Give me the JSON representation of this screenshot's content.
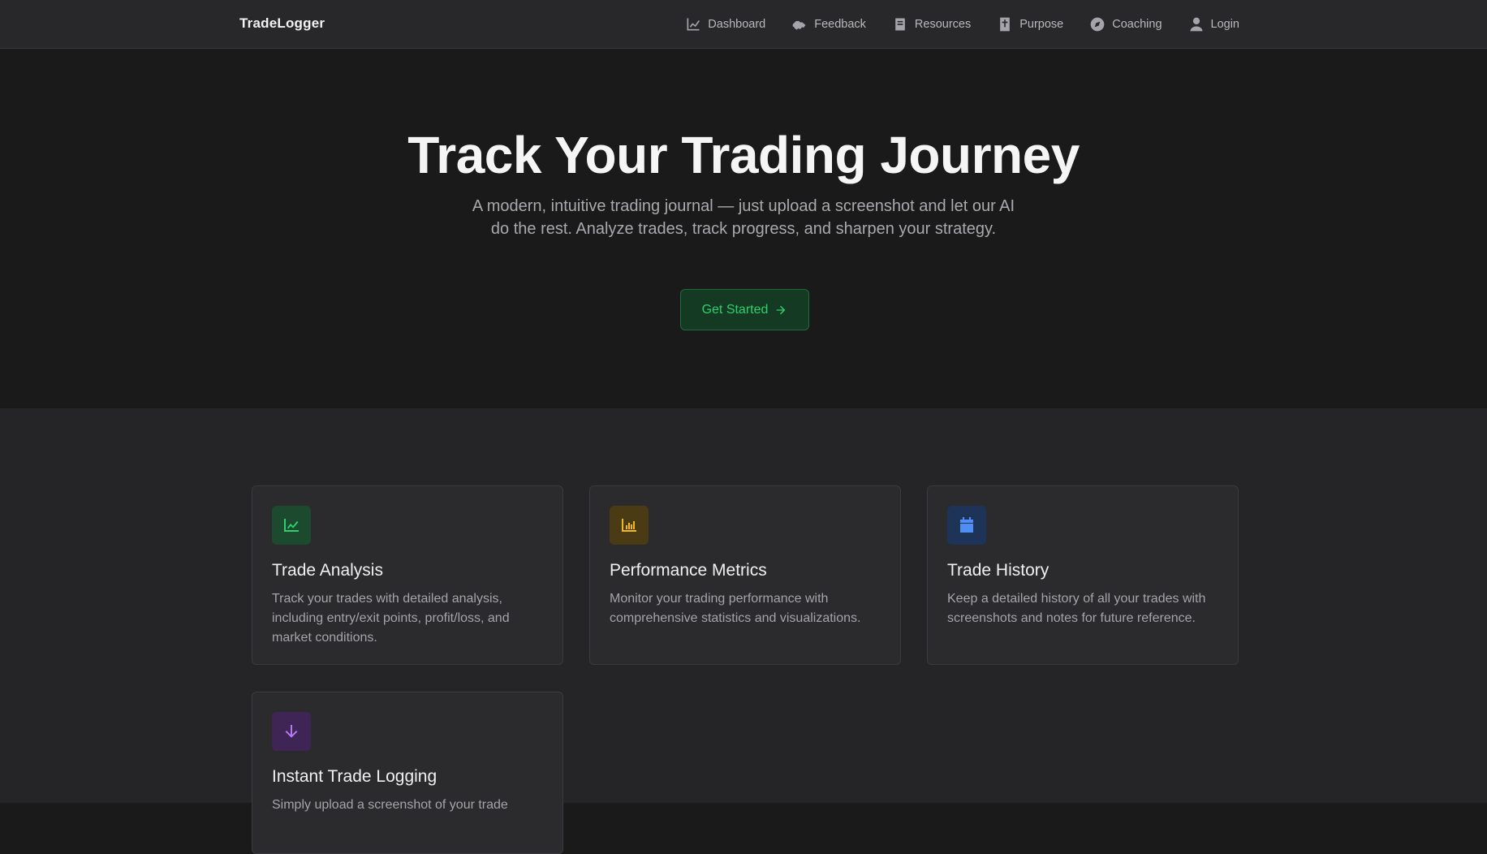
{
  "brand": "TradeLogger",
  "nav": [
    {
      "label": "Dashboard",
      "icon": "chart-line-icon"
    },
    {
      "label": "Feedback",
      "icon": "handshake-icon"
    },
    {
      "label": "Resources",
      "icon": "book-icon"
    },
    {
      "label": "Purpose",
      "icon": "bible-icon"
    },
    {
      "label": "Coaching",
      "icon": "compass-icon"
    },
    {
      "label": "Login",
      "icon": "user-icon"
    }
  ],
  "hero": {
    "title": "Track Your Trading Journey",
    "subtitle": "A modern, intuitive trading journal — just upload a screenshot and let our AI do the rest. Analyze trades, track progress, and sharpen your strategy.",
    "cta_label": "Get Started"
  },
  "features": [
    {
      "title": "Trade Analysis",
      "description": "Track your trades with detailed analysis, including entry/exit points, profit/loss, and market conditions.",
      "icon": "trend-chart-icon",
      "color": "#2fd06a"
    },
    {
      "title": "Performance Metrics",
      "description": "Monitor your trading performance with comprehensive statistics and visualizations.",
      "icon": "bar-chart-icon",
      "color": "#f2b822"
    },
    {
      "title": "Trade History",
      "description": "Keep a detailed history of all your trades with screenshots and notes for future reference.",
      "icon": "calendar-icon",
      "color": "#4f8ff5"
    },
    {
      "title": "Instant Trade Logging",
      "description": "Simply upload a screenshot of your trade",
      "icon": "arrow-down-icon",
      "color": "#b779f0"
    }
  ],
  "colors": {
    "accent_green": "#2fd06a",
    "background": "#1a1a1b",
    "navbar": "#28282a"
  }
}
